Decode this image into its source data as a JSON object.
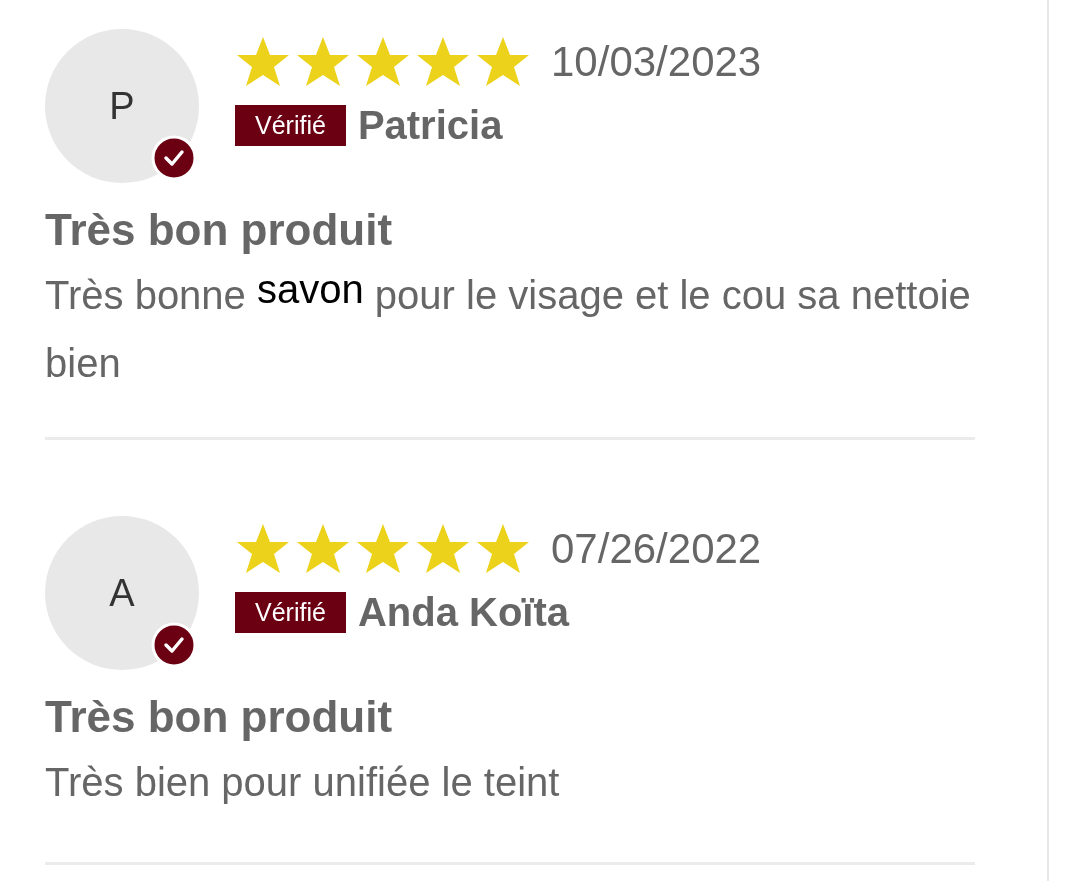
{
  "reviews": [
    {
      "initial": "P",
      "verified_check": true,
      "stars": 5,
      "date": "10/03/2023",
      "badge": "Vérifié",
      "author": "Patricia",
      "title": "Très bon produit",
      "body": [
        {
          "kind": "plain",
          "text": "Très bonne "
        },
        {
          "kind": "overlay",
          "text": "savon"
        },
        {
          "kind": "plain",
          "text": " pour le visage et le cou sa nettoie bien"
        }
      ]
    },
    {
      "initial": "A",
      "verified_check": true,
      "stars": 5,
      "date": "07/26/2022",
      "badge": "Vérifié",
      "author": "Anda Koïta",
      "title": "Très bon produit",
      "body": [
        {
          "kind": "plain",
          "text": "Très bien pour unifiée le teint"
        }
      ]
    }
  ]
}
